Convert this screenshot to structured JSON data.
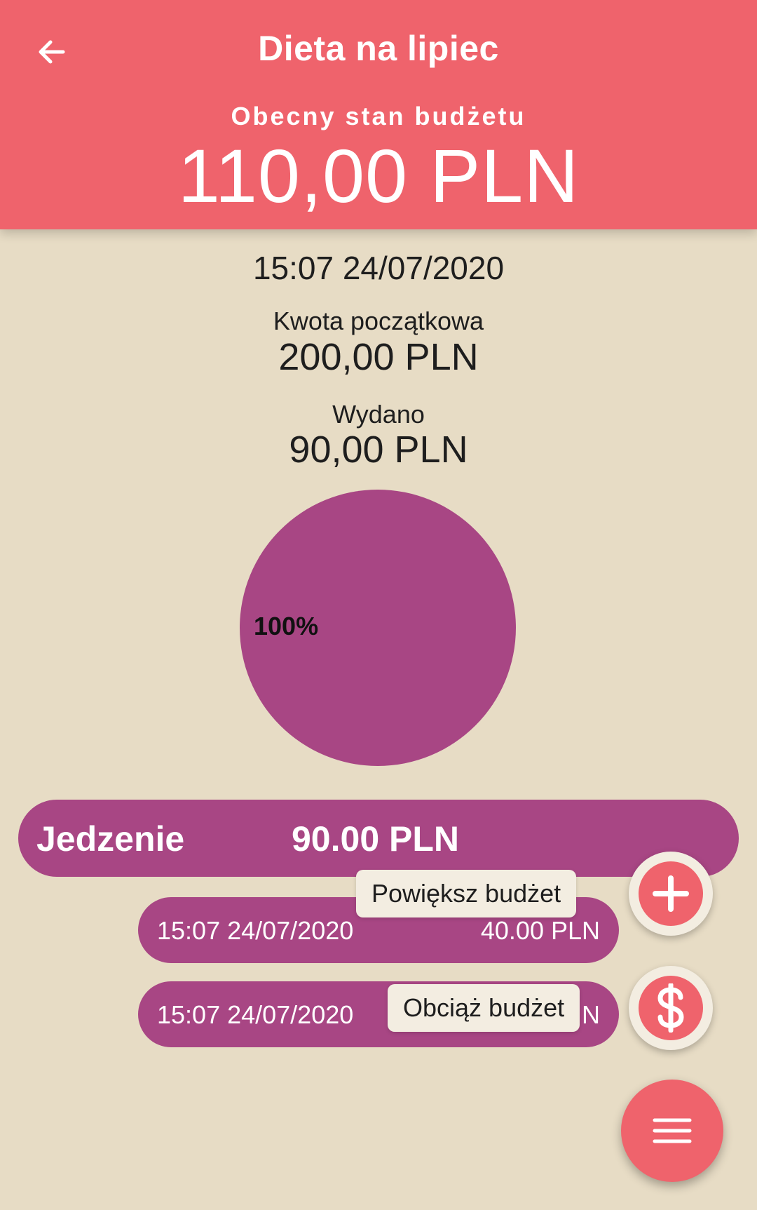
{
  "header": {
    "title": "Dieta na lipiec",
    "balance_label": "Obecny stan budżetu",
    "balance_value": "110,00 PLN"
  },
  "summary": {
    "timestamp": "15:07 24/07/2020",
    "initial_label": "Kwota początkowa",
    "initial_value": "200,00 PLN",
    "spent_label": "Wydano",
    "spent_value": "90,00 PLN"
  },
  "chart_data": {
    "type": "pie",
    "slices": [
      {
        "category": "Jedzenie",
        "value": 90.0,
        "percent": 100,
        "label": "100%",
        "color": "#a84684"
      }
    ]
  },
  "category": {
    "name": "Jedzenie",
    "amount": "90.00 PLN",
    "color": "#a84684"
  },
  "transactions": [
    {
      "date": "15:07 24/07/2020",
      "amount": "40.00 PLN"
    },
    {
      "date": "15:07 24/07/2020",
      "amount": "50.00 PLN",
      "amount_visible_fragment": "N"
    }
  ],
  "fab_menu": {
    "increase_label": "Powiększ budżet",
    "increase_icon": "plus-icon",
    "charge_label": "Obciąż budżet",
    "charge_icon": "dollar-icon",
    "main_icon": "menu-icon"
  },
  "colors": {
    "accent": "#ef636c",
    "background": "#e7dcc5",
    "category": "#a84684",
    "tooltip": "#f3ede1"
  }
}
